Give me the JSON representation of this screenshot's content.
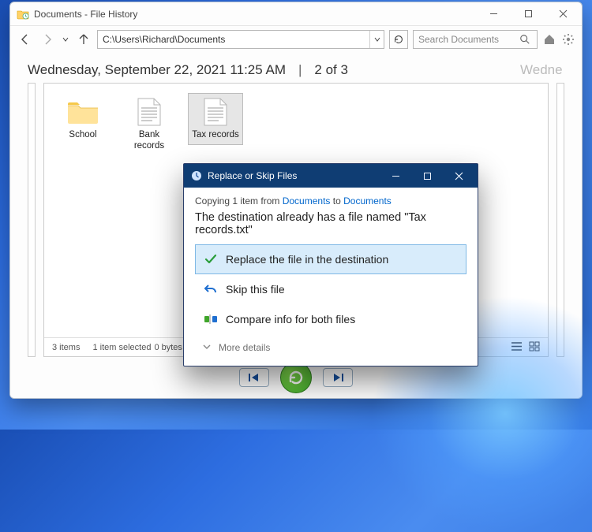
{
  "window": {
    "title": "Documents - File History"
  },
  "toolbar": {
    "path": "C:\\Users\\Richard\\Documents",
    "search_placeholder": "Search Documents"
  },
  "timeline": {
    "date": "Wednesday, September 22, 2021 11:25 AM",
    "counter": "2 of 3",
    "next": "Wedne"
  },
  "files": [
    {
      "name": "School",
      "type": "folder",
      "selected": false
    },
    {
      "name": "Bank records",
      "type": "file",
      "selected": false
    },
    {
      "name": "Tax records",
      "type": "file",
      "selected": true
    }
  ],
  "status": {
    "items": "3 items",
    "selected": "1 item selected",
    "size": "0 bytes"
  },
  "dialog": {
    "title": "Replace or Skip Files",
    "caption_prefix": "Copying 1 item from ",
    "caption_from": "Documents",
    "caption_mid": " to ",
    "caption_to": "Documents",
    "message": "The destination already has a file named \"Tax records.txt\"",
    "options": {
      "replace": "Replace the file in the destination",
      "skip": "Skip this file",
      "compare": "Compare info for both files"
    },
    "more": "More details"
  }
}
